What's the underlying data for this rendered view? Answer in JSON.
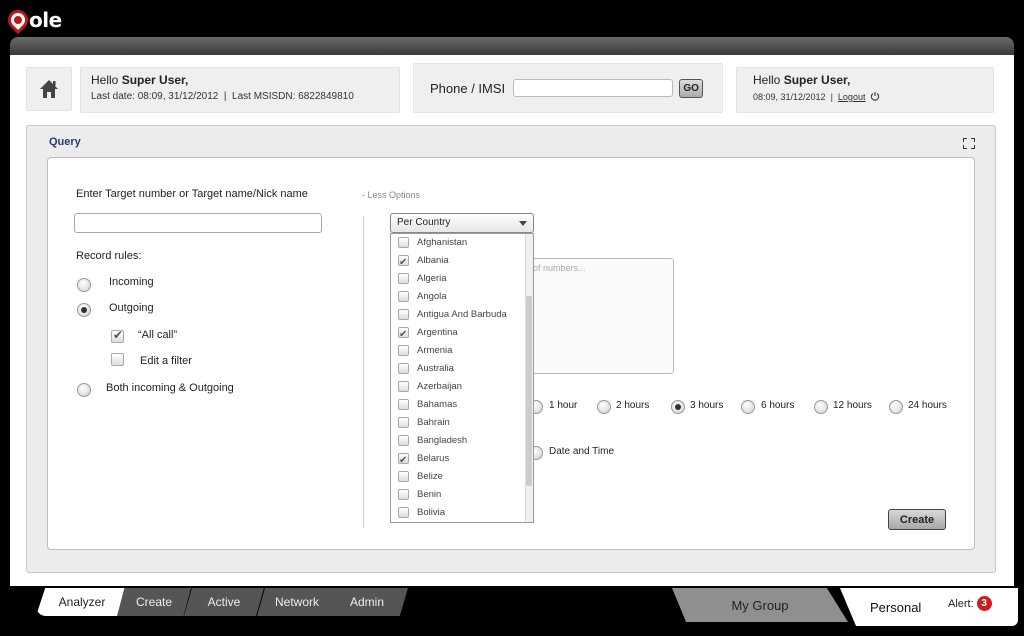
{
  "logo": {
    "text": "ole"
  },
  "header": {
    "hello_prefix": "Hello ",
    "user": "Super User,",
    "last_info": "Last date: 08:09, 31/12/2012  |  Last MSISDN: 6822849810",
    "phone_label": "Phone / IMSI",
    "phone_value": "",
    "go_label": "GO",
    "right_hello_prefix": "Hello ",
    "right_user": "Super User,",
    "right_time": "08:09, 31/12/2012  |  ",
    "logout_label": "Logout"
  },
  "query": {
    "title": "Query",
    "target_label": "Enter Target number or Target name/Nick name",
    "target_value": "",
    "less_options": "- Less Options",
    "record_rules_label": "Record rules:",
    "rules": [
      {
        "label": "Incoming",
        "selected": false
      },
      {
        "label": "Outgoing",
        "selected": true
      },
      {
        "label": "Both incoming & Outgoing",
        "selected": false
      }
    ],
    "sub_rules": [
      {
        "label": "“All call”",
        "checked": true
      },
      {
        "label": "Edit a filter",
        "checked": false
      }
    ],
    "dropdown_value": "Per Country",
    "countries": [
      {
        "name": "Afghanistan",
        "checked": false
      },
      {
        "name": "Albania",
        "checked": true
      },
      {
        "name": "Algeria",
        "checked": false
      },
      {
        "name": "Angola",
        "checked": false
      },
      {
        "name": "Antigua And Barbuda",
        "checked": false
      },
      {
        "name": "Argentina",
        "checked": true
      },
      {
        "name": "Armenia",
        "checked": false
      },
      {
        "name": "Australia",
        "checked": false
      },
      {
        "name": "Azerbaijan",
        "checked": false
      },
      {
        "name": "Bahamas",
        "checked": false
      },
      {
        "name": "Bahrain",
        "checked": false
      },
      {
        "name": "Bangladesh",
        "checked": false
      },
      {
        "name": "Belarus",
        "checked": true
      },
      {
        "name": "Belize",
        "checked": false
      },
      {
        "name": "Benin",
        "checked": false
      },
      {
        "name": "Bolivia",
        "checked": false
      }
    ],
    "numbers_placeholder": "of numbers...",
    "time_options": [
      {
        "label": "1 hour",
        "selected": false
      },
      {
        "label": "2 hours",
        "selected": false
      },
      {
        "label": "3 hours",
        "selected": true
      },
      {
        "label": "6 hours",
        "selected": false
      },
      {
        "label": "12 hours",
        "selected": false
      },
      {
        "label": "24 hours",
        "selected": false
      }
    ],
    "date_time_label": "Date and Time",
    "create_label": "Create"
  },
  "tabs": [
    {
      "label": "Analyzer",
      "active": true
    },
    {
      "label": "Create",
      "active": false
    },
    {
      "label": "Active",
      "active": false
    },
    {
      "label": "Network",
      "active": false
    },
    {
      "label": "Admin",
      "active": false
    }
  ],
  "groups": {
    "my_group": "My Group",
    "personal": "Personal"
  },
  "alert": {
    "label": "Alert:",
    "count": "3"
  }
}
